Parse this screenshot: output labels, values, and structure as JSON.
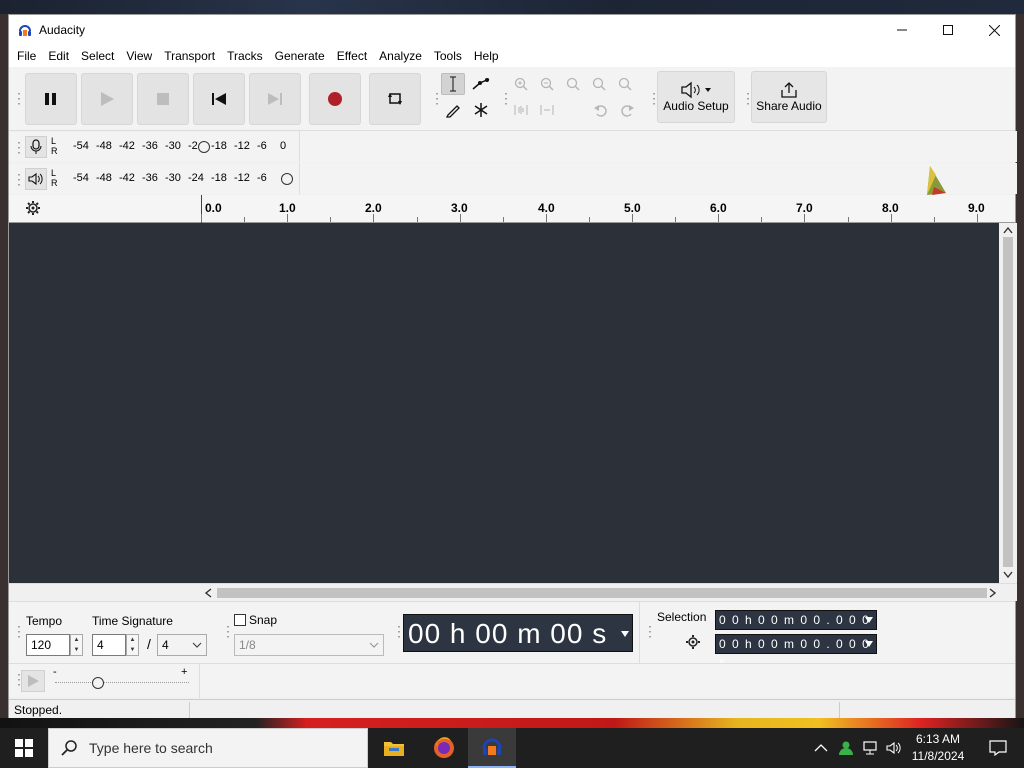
{
  "window": {
    "title": "Audacity"
  },
  "menu": [
    "File",
    "Edit",
    "Select",
    "View",
    "Transport",
    "Tracks",
    "Generate",
    "Effect",
    "Analyze",
    "Tools",
    "Help"
  ],
  "toolbar": {
    "audio_setup_label": "Audio Setup",
    "share_audio_label": "Share Audio"
  },
  "meters": {
    "record_channels": [
      "L",
      "R"
    ],
    "playback_channels": [
      "L",
      "R"
    ],
    "ticks": [
      "-54",
      "-48",
      "-42",
      "-36",
      "-30",
      "-24",
      "-18",
      "-12",
      "-6",
      "0"
    ]
  },
  "ruler": {
    "labels": [
      "0.0",
      "1.0",
      "2.0",
      "3.0",
      "4.0",
      "5.0",
      "6.0",
      "7.0",
      "8.0",
      "9.0"
    ]
  },
  "bottom": {
    "tempo_label": "Tempo",
    "tempo_value": "120",
    "time_signature_label": "Time Signature",
    "time_sig_upper": "4",
    "time_sig_slash": "/",
    "time_sig_lower": "4",
    "snap_label": "Snap",
    "snap_value": "1/8",
    "time_display": "00 h 00 m 00 s",
    "selection_label": "Selection",
    "selection_start": "0 0 h 0 0 m 0 0 . 0 0 0 s",
    "selection_end": "0 0 h 0 0 m 0 0 . 0 0 0 s"
  },
  "play_at_speed": {
    "minus": "-",
    "plus": "+"
  },
  "status": {
    "text": "Stopped."
  },
  "taskbar": {
    "search_placeholder": "Type here to search",
    "time": "6:13 AM",
    "date": "11/8/2024"
  },
  "colors": {
    "track_bg": "#2c3038",
    "record_red": "#b0202a",
    "time_display_bg": "#2d3542",
    "taskbar_bg": "#1f1f1f"
  }
}
